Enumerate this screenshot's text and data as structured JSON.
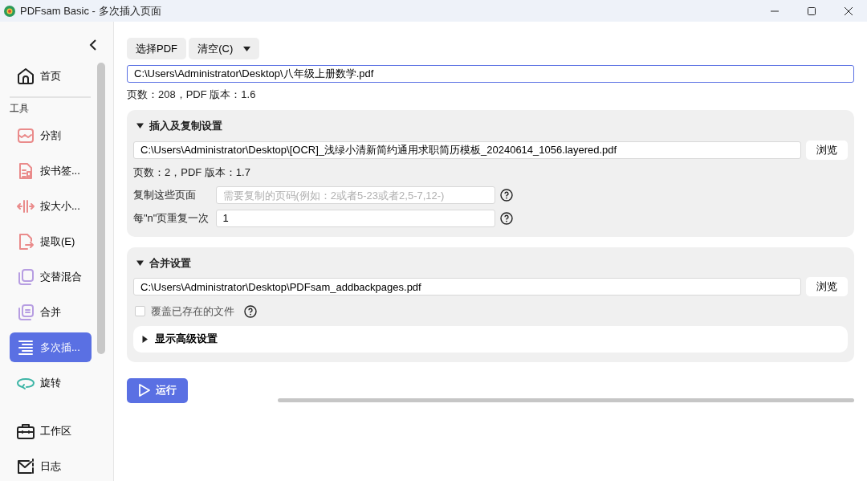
{
  "window": {
    "title": "PDFsam Basic - 多次插入页面"
  },
  "sidebar": {
    "home": {
      "label": "首页",
      "selected": false
    },
    "section_label": "工具",
    "tools": [
      {
        "label": "分割",
        "selected": false
      },
      {
        "label": "按书签...",
        "selected": false
      },
      {
        "label": "按大小...",
        "selected": false
      },
      {
        "label": "提取(E)",
        "selected": false
      },
      {
        "label": "交替混合",
        "selected": false
      },
      {
        "label": "合并",
        "selected": false
      },
      {
        "label": "多次插...",
        "selected": true
      },
      {
        "label": "旋转",
        "selected": false
      }
    ],
    "bottom": [
      {
        "label": "工作区",
        "selected": false
      },
      {
        "label": "日志",
        "selected": false
      }
    ]
  },
  "toolbar": {
    "select_button": "选择PDF",
    "clear_button": "清空(C)"
  },
  "source": {
    "value": "C:\\Users\\Administrator\\Desktop\\八年级上册数学.pdf",
    "info": "页数：208，PDF 版本：1.6"
  },
  "insert_panel": {
    "title": "插入及复制设置",
    "expanded": true,
    "file": "C:\\Users\\Administrator\\Desktop\\[OCR]_浅绿小清新简约通用求职简历模板_20240614_1056.layered.pdf",
    "browse": "浏览",
    "info": "页数：2，PDF 版本：1.7",
    "copy_label": "复制这些页面",
    "copy_placeholder": "需要复制的页码(例如：2或者5-23或者2,5-7,12-)",
    "repeat_label": "每\"n\"页重复一次",
    "repeat_value": "1"
  },
  "merge_panel": {
    "title": "合并设置",
    "expanded": true,
    "file": "C:\\Users\\Administrator\\Desktop\\PDFsam_addbackpages.pdf",
    "browse": "浏览",
    "overwrite": {
      "label": "覆盖已存在的文件",
      "checked": false
    },
    "advanced": {
      "label": "显示高级设置",
      "expanded": false
    }
  },
  "run_button": "运行"
}
